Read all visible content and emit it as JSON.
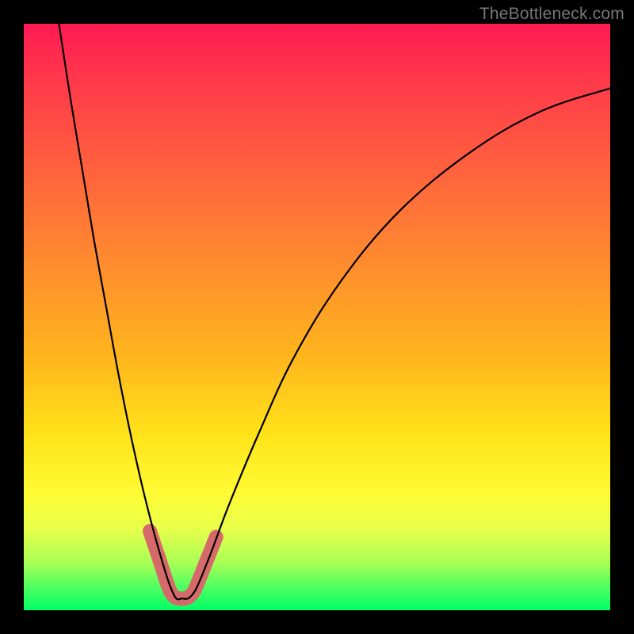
{
  "watermark": "TheBottleneck.com",
  "chart_data": {
    "type": "line",
    "title": "",
    "xlabel": "",
    "ylabel": "",
    "xlim": [
      0,
      100
    ],
    "ylim": [
      0,
      100
    ],
    "series": [
      {
        "name": "curve",
        "color": "#000000",
        "x": [
          6,
          8,
          10,
          12,
          14,
          16,
          18,
          20,
          22,
          24,
          25,
          26,
          27,
          28,
          29,
          30,
          32,
          35,
          40,
          46,
          54,
          64,
          76,
          88,
          100
        ],
        "values": [
          100,
          87,
          75,
          63,
          52,
          41,
          31,
          22,
          14,
          7,
          4,
          2,
          2,
          2,
          3,
          5,
          10,
          18,
          30,
          43,
          56,
          68,
          78,
          85,
          89
        ]
      },
      {
        "name": "highlight",
        "color": "#d66a6a",
        "x": [
          21.5,
          22.5,
          23.5,
          24.3,
          25.0,
          25.8,
          26.6,
          27.4,
          28.2,
          29.0,
          29.8,
          30.8,
          31.8,
          32.8
        ],
        "values": [
          13.5,
          10.5,
          7.5,
          5.0,
          3.2,
          2.2,
          2.0,
          2.0,
          2.3,
          3.2,
          5.0,
          7.5,
          10.0,
          12.5
        ]
      }
    ],
    "highlight_style": {
      "stroke_width": 18,
      "linecap": "round"
    },
    "curve_style": {
      "stroke_width": 2.2
    }
  }
}
